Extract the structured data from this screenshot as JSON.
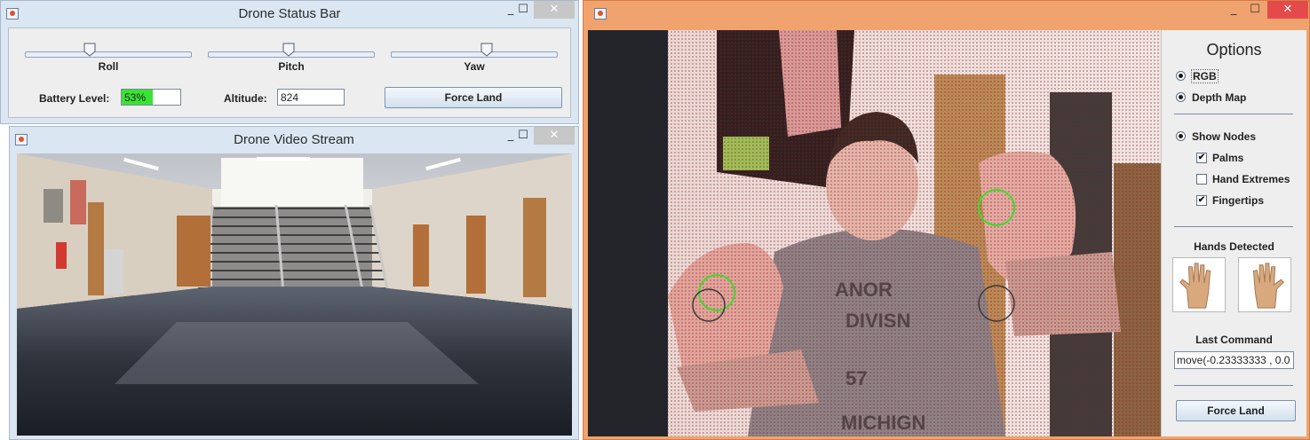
{
  "status_window": {
    "title": "Drone Status Bar",
    "controls": {
      "minimize": "_",
      "maximize": "☐",
      "close": "✕"
    },
    "sliders": [
      {
        "label": "Roll",
        "value_fraction": 0.38
      },
      {
        "label": "Pitch",
        "value_fraction": 0.48
      },
      {
        "label": "Yaw",
        "value_fraction": 0.58
      }
    ],
    "battery": {
      "label": "Battery Level:",
      "value_text": "53%",
      "percent": 53,
      "color": "#39e333"
    },
    "altitude": {
      "label": "Altitude:",
      "value": "824"
    },
    "force_land_label": "Force Land"
  },
  "video_window": {
    "title": "Drone Video Stream",
    "controls": {
      "minimize": "_",
      "maximize": "☐",
      "close": "✕"
    }
  },
  "kinect_window": {
    "title": "",
    "controls": {
      "minimize": "_",
      "maximize": "☐",
      "close": "✕"
    },
    "accent": "#f0a36e",
    "options": {
      "title": "Options",
      "view_modes": [
        {
          "label": "RGB",
          "selected": true
        },
        {
          "label": "Depth Map",
          "selected": true
        }
      ],
      "show_nodes": {
        "label": "Show Nodes",
        "selected": true
      },
      "node_checks": [
        {
          "label": "Palms",
          "checked": true
        },
        {
          "label": "Hand Extremes",
          "checked": false
        },
        {
          "label": "Fingertips",
          "checked": true
        }
      ],
      "hands_detected_label": "Hands Detected",
      "hands": [
        "left-hand-icon",
        "right-hand-icon"
      ],
      "last_command_label": "Last Command",
      "last_command_value": "move(-0.23333333 , 0.0",
      "force_land_label": "Force Land"
    }
  }
}
